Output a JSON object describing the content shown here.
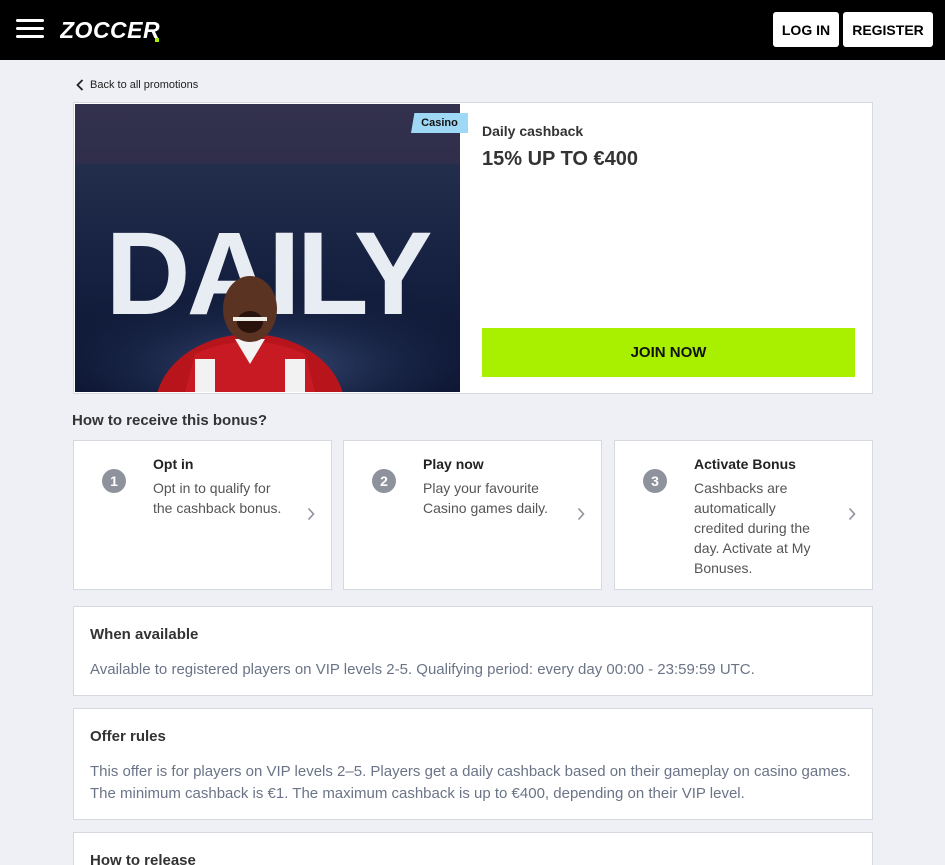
{
  "header": {
    "logo_text": "ZOCCER",
    "login_label": "LOG IN",
    "register_label": "REGISTER"
  },
  "back_link": "Back to all promotions",
  "promo": {
    "tag": "Casino",
    "category": "Daily cashback",
    "title": "15% UP TO €400",
    "image_word": "DAILY",
    "cta": "JOIN NOW"
  },
  "how_to": {
    "heading": "How to receive this bonus?",
    "steps": [
      {
        "num": "1",
        "title": "Opt in",
        "desc": "Opt in to qualify for the cashback bonus."
      },
      {
        "num": "2",
        "title": "Play now",
        "desc": "Play your favourite Casino games daily."
      },
      {
        "num": "3",
        "title": "Activate Bonus",
        "desc": "Cashbacks are automatically credited during the day. Activate at My Bonuses."
      }
    ]
  },
  "when_available": {
    "title": "When available",
    "text": "Available to registered players on VIP levels 2-5. Qualifying period: every day 00:00 - 23:59:59 UTC."
  },
  "offer_rules": {
    "title": "Offer rules",
    "text": "This offer is for players on VIP levels 2–5. Players get a daily cashback based on their gameplay on casino games. The minimum cashback is €1. The maximum cashback is up to €400, depending on their VIP level."
  },
  "how_to_release": {
    "title": "How to release"
  },
  "colors": {
    "accent": "#a8ef00",
    "tag": "#9fd8f4",
    "topbar": "#000000"
  }
}
